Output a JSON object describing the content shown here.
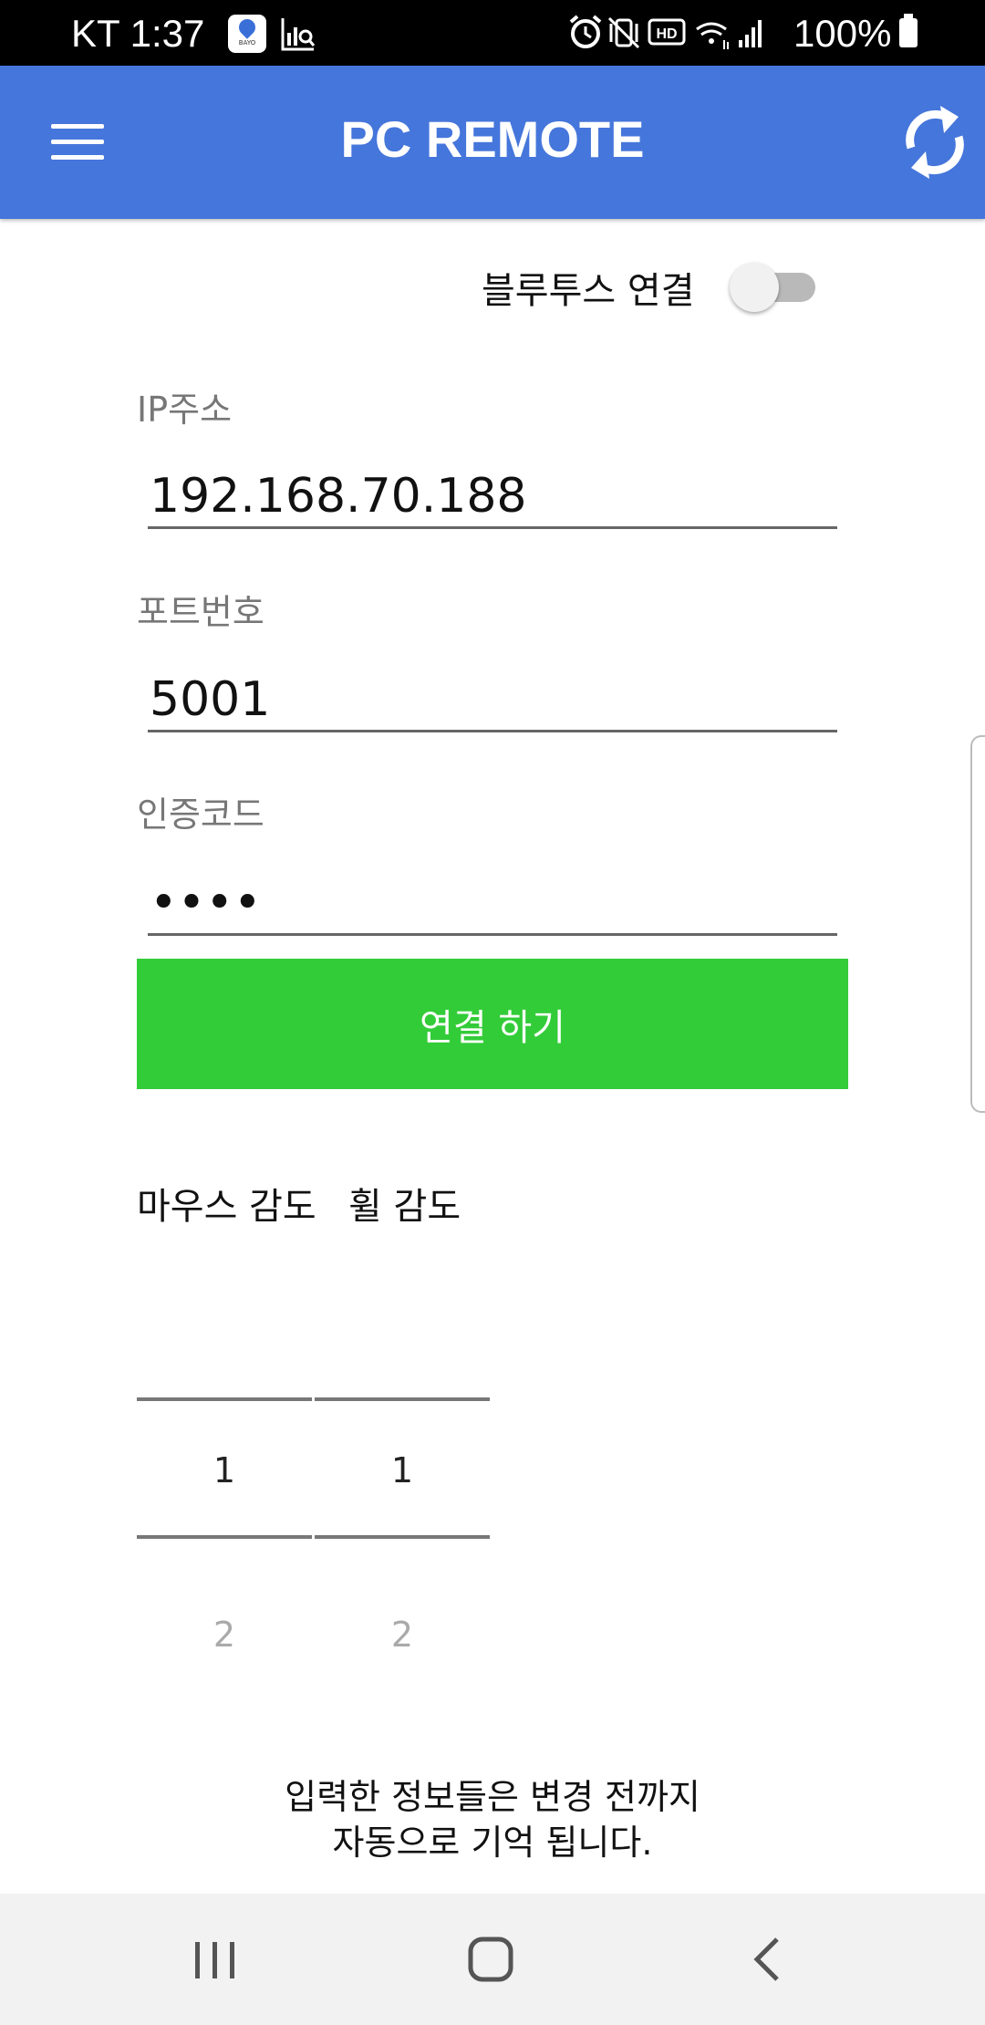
{
  "status_bar": {
    "carrier_time": "KT 1:37",
    "app_icon_label": "BAYO",
    "battery": "100%",
    "icons": [
      "app-map-pin-icon",
      "chart-search-icon",
      "alarm-icon",
      "vibrate-mute-icon",
      "hd-voice-icon",
      "wifi-icon",
      "signal-icon",
      "battery-icon"
    ]
  },
  "app_bar": {
    "title": "PC REMOTE",
    "left_icon": "menu-icon",
    "right_icon": "refresh-icon",
    "color": "#4576db"
  },
  "bluetooth": {
    "label": "블루투스 연결",
    "enabled": false
  },
  "form": {
    "ip": {
      "label": "IP주소",
      "value": "192.168.70.188"
    },
    "port": {
      "label": "포트번호",
      "value": "5001"
    },
    "auth": {
      "label": "인증코드",
      "value": "••••"
    }
  },
  "connect_button": {
    "label": "연결 하기",
    "color": "#33cc39"
  },
  "sensitivity": {
    "mouse": {
      "label": "마우스 감도",
      "selected": "1",
      "next": "2"
    },
    "wheel": {
      "label": "휠 감도",
      "selected": "1",
      "next": "2"
    }
  },
  "info_note": {
    "line1": "입력한 정보들은 변경 전까지",
    "line2": "자동으로 기억 됩니다."
  },
  "nav_bar": {
    "buttons": [
      "recent-apps-icon",
      "home-icon",
      "back-icon"
    ]
  }
}
